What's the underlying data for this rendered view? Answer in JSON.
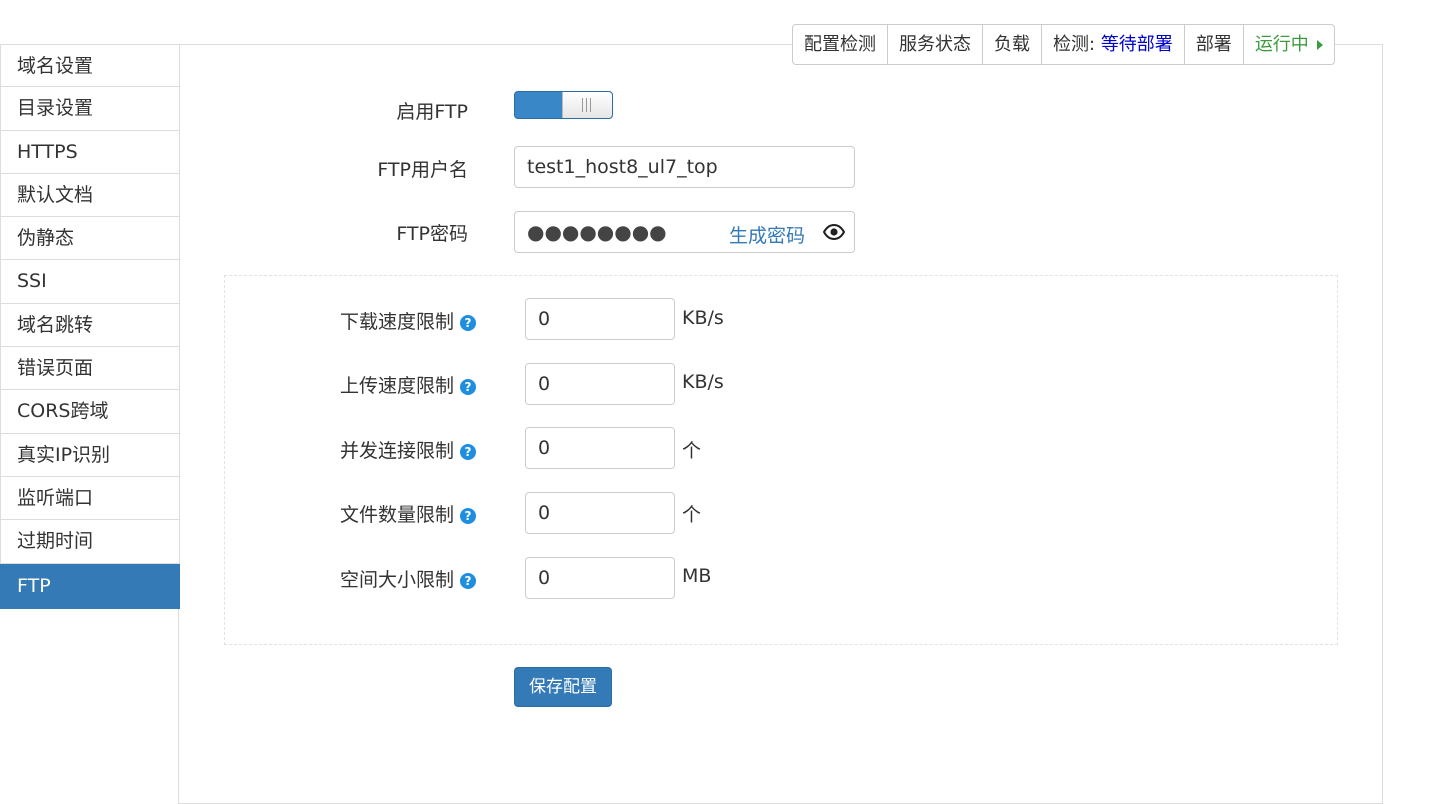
{
  "sidebar": {
    "items": [
      {
        "label": "域名设置"
      },
      {
        "label": "目录设置"
      },
      {
        "label": "HTTPS"
      },
      {
        "label": "默认文档"
      },
      {
        "label": "伪静态"
      },
      {
        "label": "SSI"
      },
      {
        "label": "域名跳转"
      },
      {
        "label": "错误页面"
      },
      {
        "label": "CORS跨域"
      },
      {
        "label": "真实IP识别"
      },
      {
        "label": "监听端口"
      },
      {
        "label": "过期时间"
      },
      {
        "label": "FTP"
      }
    ],
    "active_index": 12
  },
  "toolbar": {
    "config_check": "配置检测",
    "service_status": "服务状态",
    "load": "负载",
    "detect_label": "检测:",
    "detect_value": "等待部署",
    "deploy": "部署",
    "running": "运行中"
  },
  "form": {
    "enable_ftp_label": "启用FTP",
    "enable_ftp_on": true,
    "username_label": "FTP用户名",
    "username_value": "test1_host8_ul7_top",
    "password_label": "FTP密码",
    "password_masked": "●●●●●●●●",
    "generate_password": "生成密码"
  },
  "limits": [
    {
      "label": "下载速度限制",
      "value": "0",
      "unit": "KB/s"
    },
    {
      "label": "上传速度限制",
      "value": "0",
      "unit": "KB/s"
    },
    {
      "label": "并发连接限制",
      "value": "0",
      "unit": "个"
    },
    {
      "label": "文件数量限制",
      "value": "0",
      "unit": "个"
    },
    {
      "label": "空间大小限制",
      "value": "0",
      "unit": "MB"
    }
  ],
  "help_glyph": "?",
  "save_label": "保存配置",
  "colors": {
    "primary": "#337ab7",
    "link": "#0000cc",
    "running": "#3c9c3c",
    "help": "#1e8ee0"
  }
}
